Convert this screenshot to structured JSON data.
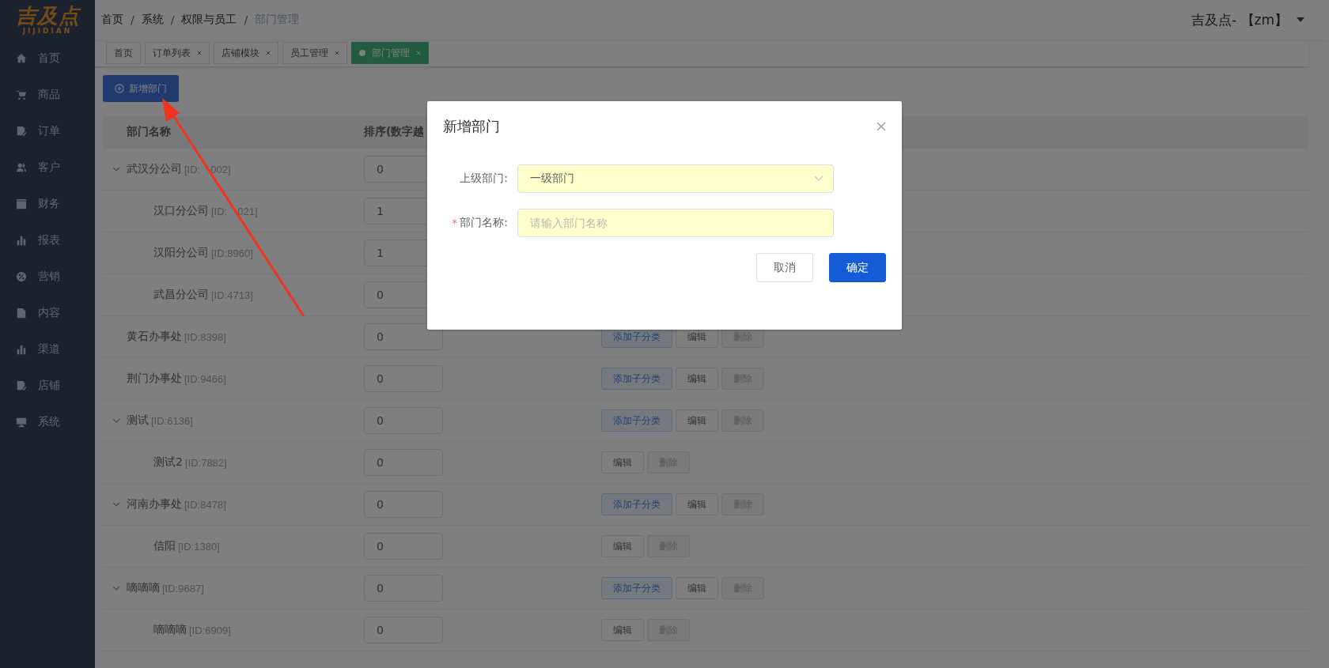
{
  "logo": {
    "text": "吉及点",
    "subtext": "JIJIDIAN"
  },
  "sidebar": {
    "items": [
      {
        "label": "首页"
      },
      {
        "label": "商品"
      },
      {
        "label": "订单"
      },
      {
        "label": "客户"
      },
      {
        "label": "财务"
      },
      {
        "label": "报表"
      },
      {
        "label": "营销"
      },
      {
        "label": "内容"
      },
      {
        "label": "渠道"
      },
      {
        "label": "店铺"
      },
      {
        "label": "系统"
      }
    ]
  },
  "header": {
    "breadcrumb": [
      "首页",
      "系统",
      "权限与员工",
      "部门管理"
    ],
    "separator": "/",
    "user": "吉及点- 【zm】"
  },
  "tabs": [
    {
      "label": "首页",
      "selected": false,
      "closable": false
    },
    {
      "label": "订单列表",
      "selected": false,
      "closable": true
    },
    {
      "label": "店铺模块",
      "selected": false,
      "closable": true
    },
    {
      "label": "员工管理",
      "selected": false,
      "closable": true
    },
    {
      "label": "部门管理",
      "selected": true,
      "closable": true
    }
  ],
  "add_button": "新增部门",
  "table": {
    "columns": [
      "部门名称",
      "排序(数字越"
    ],
    "rows": [
      {
        "name": "武汉分公司",
        "id_parts": [
          "[ID:",
          "002]"
        ],
        "sort": "0",
        "expanded": true,
        "children": [
          {
            "name": "汉口分公司",
            "id_parts": [
              "[ID:",
              "021]"
            ],
            "sort": "1"
          },
          {
            "name": "汉阳分公司",
            "id": "[ID:8960]",
            "sort": "1"
          },
          {
            "name": "武昌分公司",
            "id": "[ID:4713]",
            "sort": "0"
          }
        ]
      },
      {
        "name": "黄石办事处",
        "id": "[ID:8398]",
        "sort": "0",
        "actions": [
          {
            "kind": "add",
            "label": "添加子分类"
          },
          {
            "kind": "edit",
            "label": "编辑"
          },
          {
            "kind": "delete",
            "label": "删除"
          }
        ]
      },
      {
        "name": "荆门办事处",
        "id": "[ID:9466]",
        "sort": "0",
        "actions": [
          {
            "kind": "add",
            "label": "添加子分类"
          },
          {
            "kind": "edit",
            "label": "编辑"
          },
          {
            "kind": "delete",
            "label": "删除"
          }
        ]
      },
      {
        "name": "测试",
        "id": "[ID:6136]",
        "sort": "0",
        "expanded": true,
        "actions": [
          {
            "kind": "add",
            "label": "添加子分类"
          },
          {
            "kind": "edit",
            "label": "编辑"
          },
          {
            "kind": "delete",
            "label": "删除"
          }
        ],
        "children": [
          {
            "name": "测试2",
            "id": "[ID:7882]",
            "sort": "0",
            "actions": [
              {
                "kind": "edit",
                "label": "编辑"
              },
              {
                "kind": "delete",
                "label": "删除"
              }
            ]
          }
        ]
      },
      {
        "name": "河南办事处",
        "id": "[ID:8478]",
        "sort": "0",
        "expanded": true,
        "actions": [
          {
            "kind": "add",
            "label": "添加子分类"
          },
          {
            "kind": "edit",
            "label": "编辑"
          },
          {
            "kind": "delete",
            "label": "删除"
          }
        ],
        "children": [
          {
            "name": "信阳",
            "id": "[ID:1380]",
            "sort": "0",
            "actions": [
              {
                "kind": "edit",
                "label": "编辑"
              },
              {
                "kind": "delete",
                "label": "删除"
              }
            ]
          }
        ]
      },
      {
        "name": "嘀嘀嘀",
        "id": "[ID:9687]",
        "sort": "0",
        "expanded": true,
        "actions": [
          {
            "kind": "add",
            "label": "添加子分类"
          },
          {
            "kind": "edit",
            "label": "编辑"
          },
          {
            "kind": "delete",
            "label": "删除"
          }
        ],
        "children": [
          {
            "name": "嘀嘀嘀",
            "id": "[ID:6909]",
            "sort": "0",
            "actions": [
              {
                "kind": "edit",
                "label": "编辑"
              },
              {
                "kind": "delete",
                "label": "删除"
              }
            ]
          }
        ]
      }
    ]
  },
  "dialog": {
    "title": "新增部门",
    "required_mark": "*",
    "fields": [
      {
        "kind": "select",
        "label": "上级部门:",
        "required": false,
        "value": "一级部门"
      },
      {
        "kind": "input",
        "label": "部门名称:",
        "required": true,
        "placeholder": "请输入部门名称"
      }
    ],
    "buttons": [
      {
        "kind": "cancel",
        "label": "取消"
      },
      {
        "kind": "primary",
        "label": "确定"
      }
    ]
  }
}
